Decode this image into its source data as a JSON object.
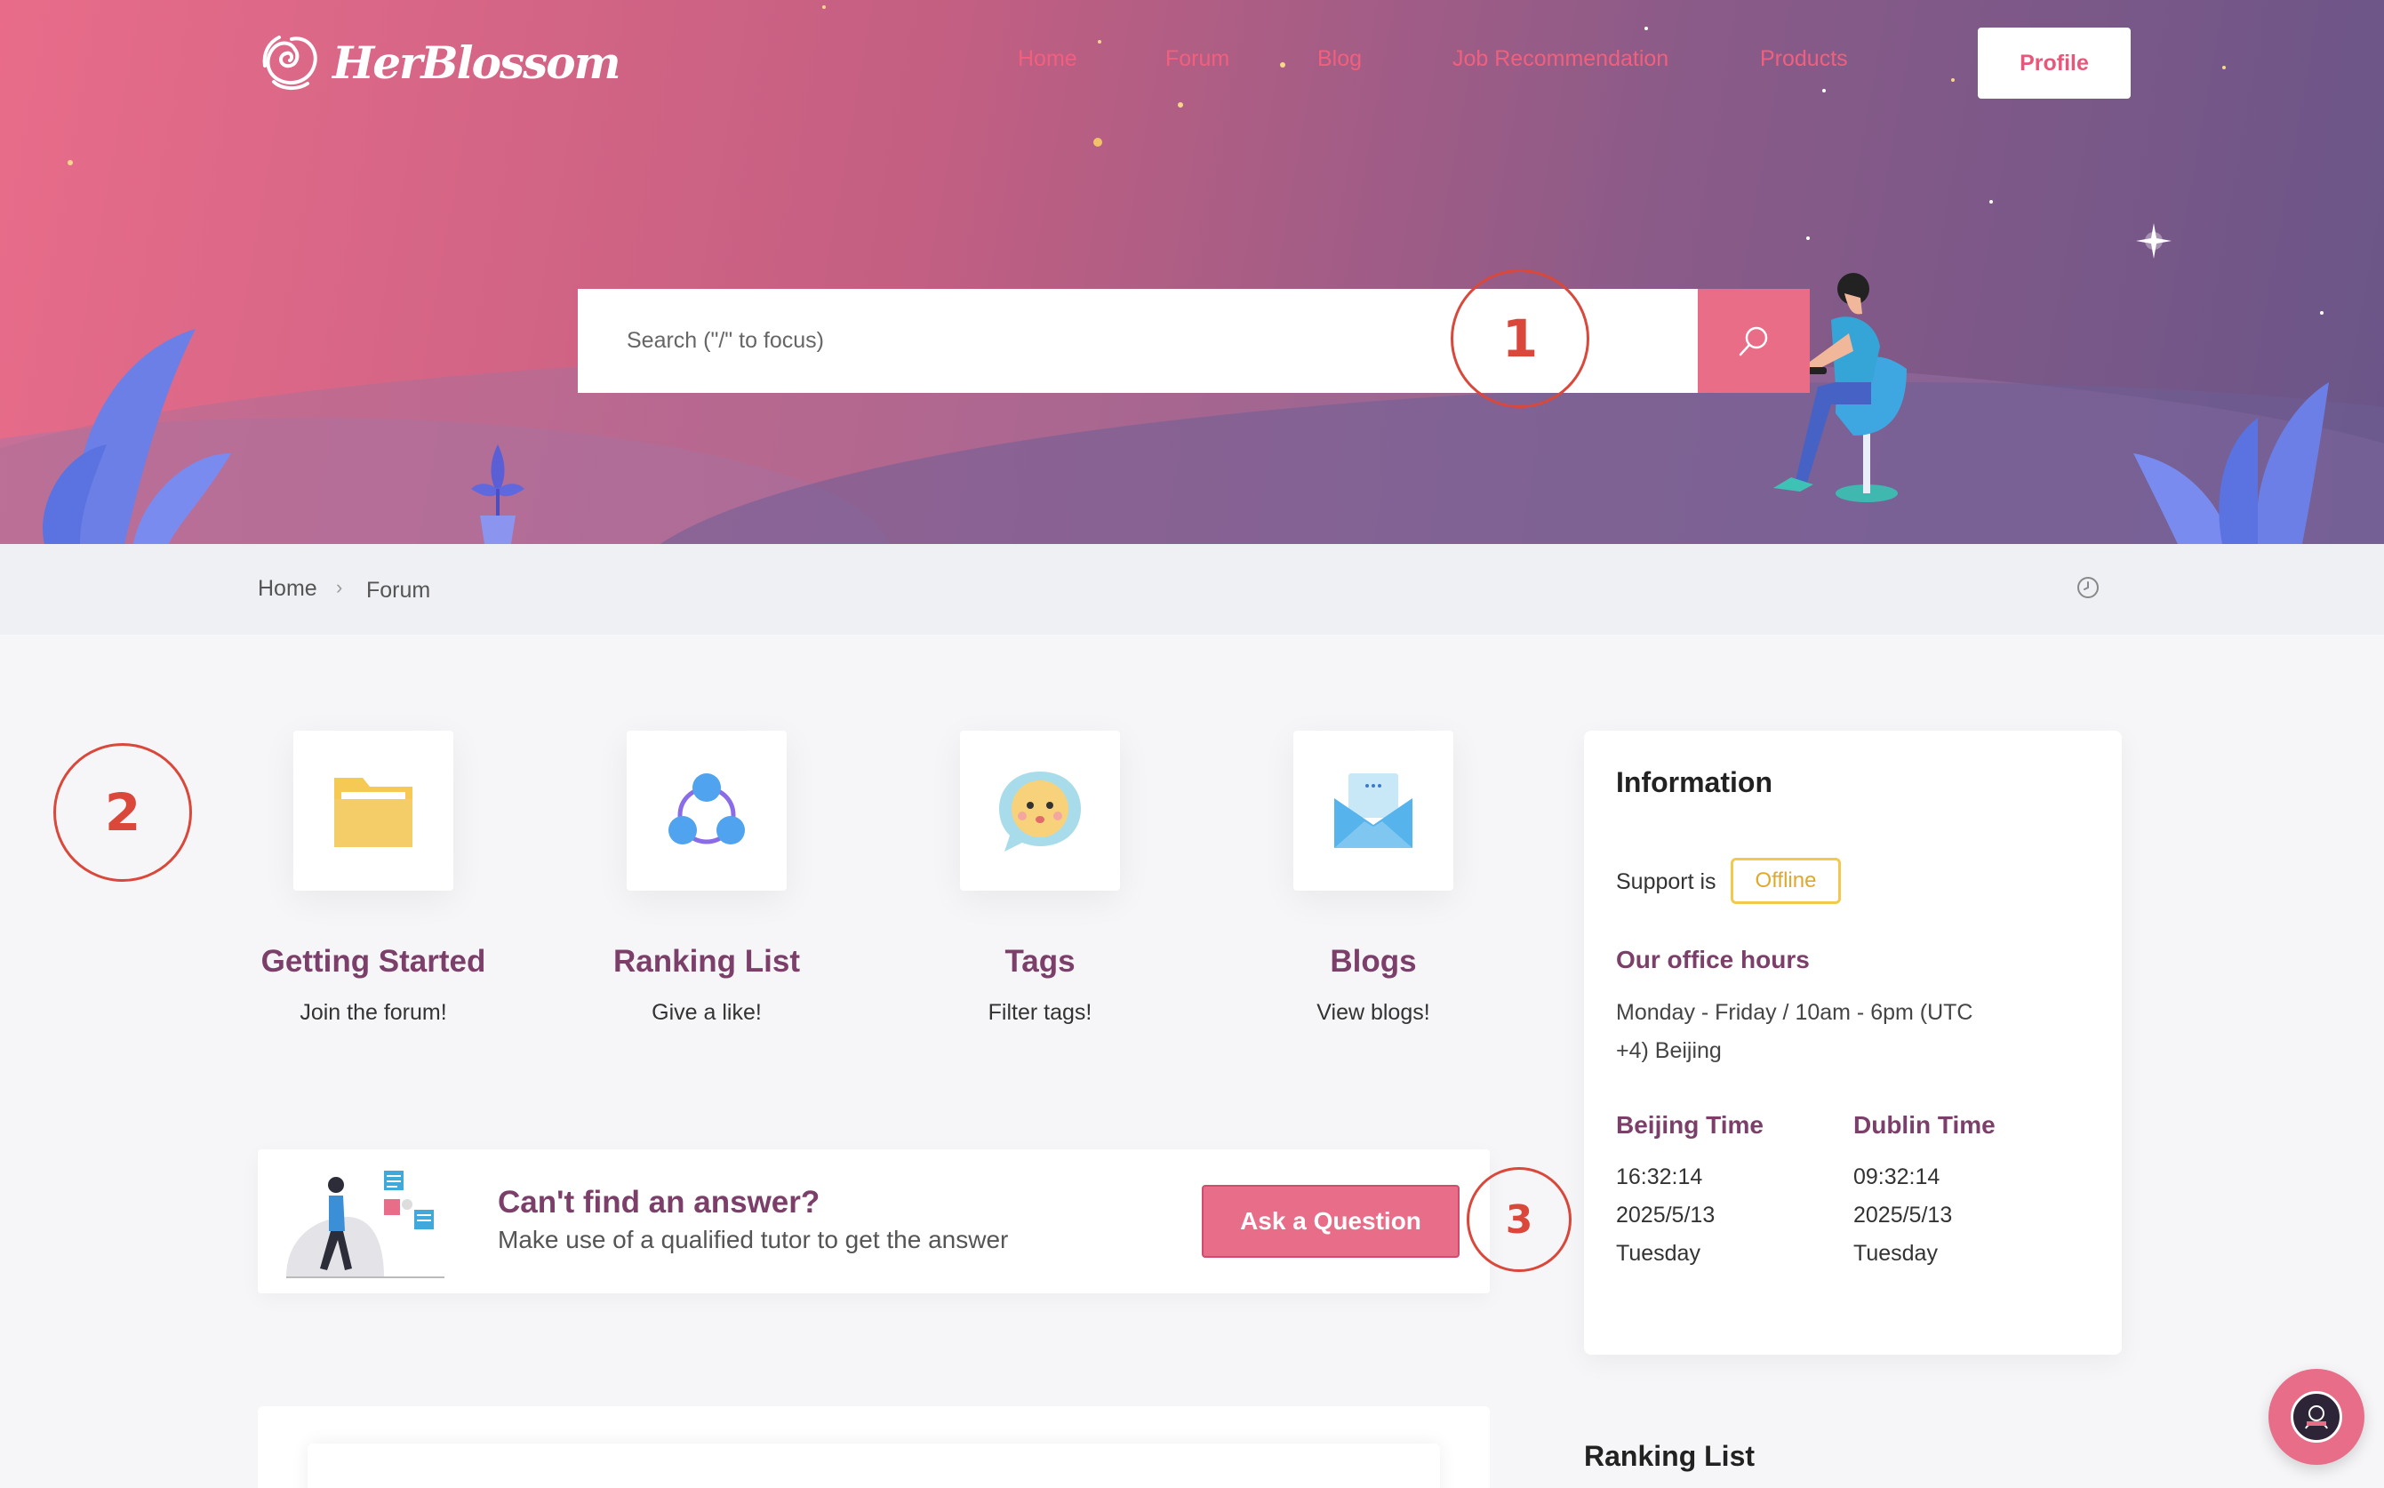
{
  "brand": {
    "name": "HerBlossom"
  },
  "nav": {
    "items": [
      "Home",
      "Forum",
      "Blog",
      "Job Recommendation",
      "Products"
    ],
    "profile_label": "Profile"
  },
  "search": {
    "placeholder": "Search (\"/\" to focus)"
  },
  "callouts": [
    "1",
    "2",
    "3"
  ],
  "breadcrumb": {
    "home": "Home",
    "separator": "›",
    "current": "Forum"
  },
  "features": [
    {
      "title": "Getting Started",
      "subtitle": "Join the forum!",
      "icon": "folder-icon"
    },
    {
      "title": "Ranking List",
      "subtitle": "Give a like!",
      "icon": "network-icon"
    },
    {
      "title": "Tags",
      "subtitle": "Filter tags!",
      "icon": "chat-emoji-icon"
    },
    {
      "title": "Blogs",
      "subtitle": "View blogs!",
      "icon": "envelope-icon"
    }
  ],
  "ask": {
    "title": "Can't find an answer?",
    "subtitle": "Make use of a qualified tutor to get the answer",
    "button": "Ask a Question"
  },
  "info": {
    "title": "Information",
    "support_label": "Support is",
    "support_status": "Offline",
    "office_title": "Our office hours",
    "office_hours": "Monday - Friday / 10am - 6pm (UTC +4) Beijing",
    "zones": [
      {
        "title": "Beijing Time",
        "time": "16:32:14",
        "date": "2025/5/13",
        "day": "Tuesday"
      },
      {
        "title": "Dublin Time",
        "time": "09:32:14",
        "date": "2025/5/13",
        "day": "Tuesday"
      }
    ]
  },
  "ranking": {
    "title": "Ranking List"
  },
  "colors": {
    "accent": "#e86d89",
    "heading": "#7b3f6a",
    "badge": "#f2c94c",
    "callout": "#d9483a"
  }
}
